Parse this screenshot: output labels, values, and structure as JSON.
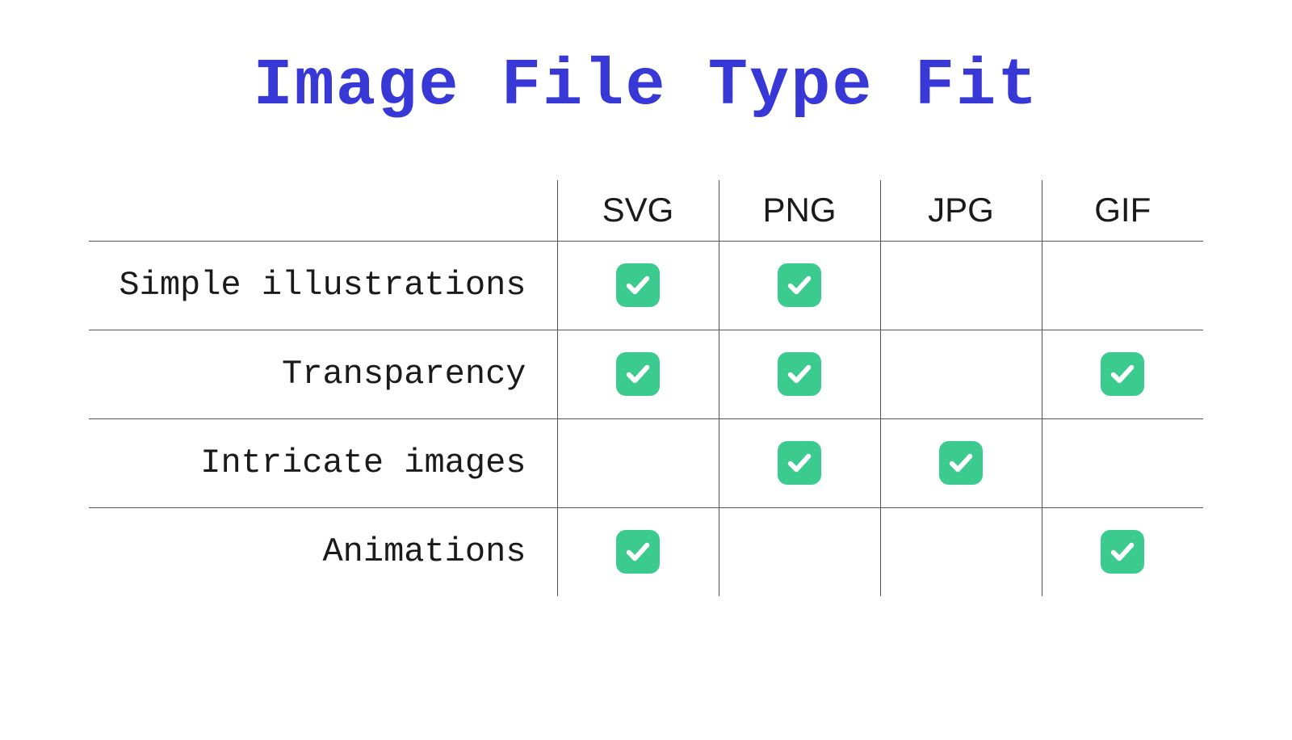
{
  "title": "Image File Type Fit",
  "columns": [
    "SVG",
    "PNG",
    "JPG",
    "GIF"
  ],
  "rows": [
    {
      "label": "Simple illustrations",
      "values": [
        true,
        true,
        false,
        false
      ]
    },
    {
      "label": "Transparency",
      "values": [
        true,
        true,
        false,
        true
      ]
    },
    {
      "label": "Intricate images",
      "values": [
        false,
        true,
        true,
        false
      ]
    },
    {
      "label": "Animations",
      "values": [
        true,
        false,
        false,
        true
      ]
    }
  ],
  "chart_data": {
    "type": "table",
    "title": "Image File Type Fit",
    "columns": [
      "SVG",
      "PNG",
      "JPG",
      "GIF"
    ],
    "rows": [
      "Simple illustrations",
      "Transparency",
      "Intricate images",
      "Animations"
    ],
    "matrix": [
      [
        1,
        1,
        0,
        0
      ],
      [
        1,
        1,
        0,
        1
      ],
      [
        0,
        1,
        1,
        0
      ],
      [
        1,
        0,
        0,
        1
      ]
    ]
  }
}
